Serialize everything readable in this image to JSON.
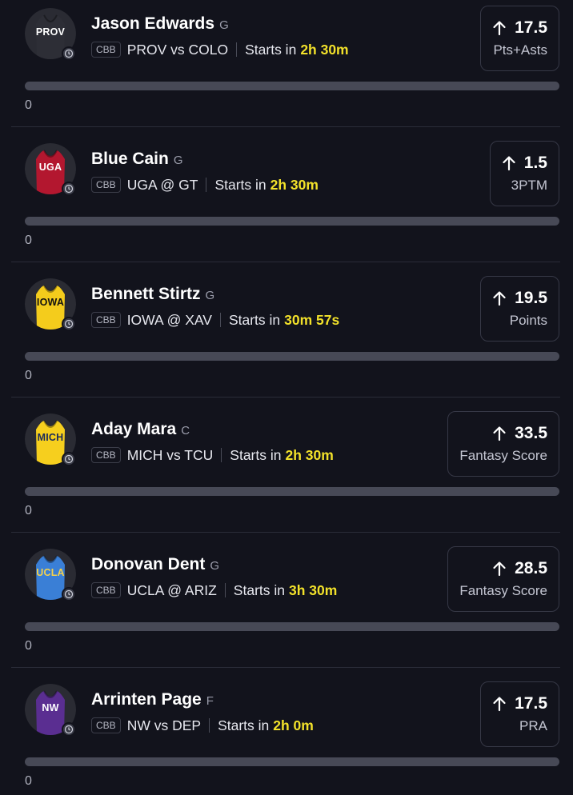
{
  "colors": {
    "background": "#12131c",
    "countdown": "#f2e12a",
    "track": "#474956"
  },
  "props": [
    {
      "team_code": "PROV",
      "jersey_color": "#2d2e36",
      "code_color": "#ffffff",
      "name": "Jason Edwards",
      "position": "G",
      "league": "CBB",
      "matchup": "PROV vs COLO",
      "starts_label": "Starts in",
      "countdown": "2h 30m",
      "line": "17.5",
      "stat": "Pts+Asts",
      "direction_icon": "arrow-up-icon",
      "progress_value": "0",
      "progress_fraction": 0
    },
    {
      "team_code": "UGA",
      "jersey_color": "#b3172f",
      "code_color": "#ffffff",
      "name": "Blue Cain",
      "position": "G",
      "league": "CBB",
      "matchup": "UGA @ GT",
      "starts_label": "Starts in",
      "countdown": "2h 30m",
      "line": "1.5",
      "stat": "3PTM",
      "direction_icon": "arrow-up-icon",
      "progress_value": "0",
      "progress_fraction": 0
    },
    {
      "team_code": "IOWA",
      "jersey_color": "#f4cc1c",
      "code_color": "#111111",
      "name": "Bennett Stirtz",
      "position": "G",
      "league": "CBB",
      "matchup": "IOWA @ XAV",
      "starts_label": "Starts in",
      "countdown": "30m 57s",
      "line": "19.5",
      "stat": "Points",
      "direction_icon": "arrow-up-icon",
      "progress_value": "0",
      "progress_fraction": 0
    },
    {
      "team_code": "MICH",
      "jersey_color": "#f6cf1e",
      "code_color": "#1a2a5a",
      "name": "Aday Mara",
      "position": "C",
      "league": "CBB",
      "matchup": "MICH vs TCU",
      "starts_label": "Starts in",
      "countdown": "2h 30m",
      "line": "33.5",
      "stat": "Fantasy Score",
      "direction_icon": "arrow-up-icon",
      "progress_value": "0",
      "progress_fraction": 0
    },
    {
      "team_code": "UCLA",
      "jersey_color": "#3a7fd6",
      "code_color": "#f6d24a",
      "name": "Donovan Dent",
      "position": "G",
      "league": "CBB",
      "matchup": "UCLA @ ARIZ",
      "starts_label": "Starts in",
      "countdown": "3h 30m",
      "line": "28.5",
      "stat": "Fantasy Score",
      "direction_icon": "arrow-up-icon",
      "progress_value": "0",
      "progress_fraction": 0
    },
    {
      "team_code": "NW",
      "jersey_color": "#5a2e91",
      "code_color": "#ffffff",
      "name": "Arrinten Page",
      "position": "F",
      "league": "CBB",
      "matchup": "NW vs DEP",
      "starts_label": "Starts in",
      "countdown": "2h 0m",
      "line": "17.5",
      "stat": "PRA",
      "direction_icon": "arrow-up-icon",
      "progress_value": "0",
      "progress_fraction": 0
    }
  ]
}
